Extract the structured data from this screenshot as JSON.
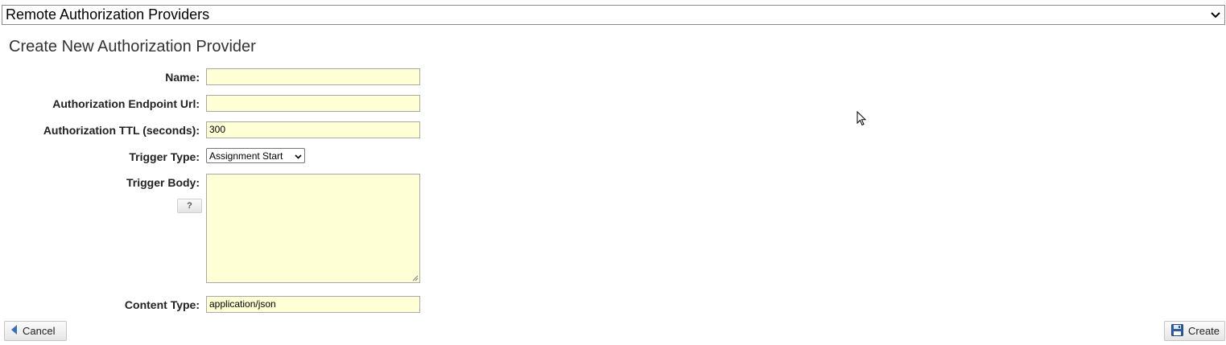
{
  "provider_select": {
    "selected": "Remote Authorization Providers",
    "icon": "chevron-down-icon"
  },
  "page": {
    "title": "Create New Authorization Provider"
  },
  "form": {
    "name": {
      "label": "Name:",
      "value": ""
    },
    "endpoint": {
      "label": "Authorization Endpoint Url:",
      "value": ""
    },
    "ttl": {
      "label": "Authorization TTL (seconds):",
      "value": "300"
    },
    "trigger_type": {
      "label": "Trigger Type:",
      "selected": "Assignment Start"
    },
    "trigger_body": {
      "label": "Trigger Body:",
      "value": "",
      "help_label": "?"
    },
    "content_type": {
      "label": "Content Type:",
      "value": "application/json"
    }
  },
  "actions": {
    "cancel_label": "Cancel",
    "create_label": "Create",
    "cancel_icon": "triangle-left-icon",
    "create_icon": "floppy-disk-icon"
  },
  "colors": {
    "field_background": "#ffffd6",
    "cancel_icon_color": "#3b6fb6",
    "create_icon_color": "#2f5e9e"
  }
}
